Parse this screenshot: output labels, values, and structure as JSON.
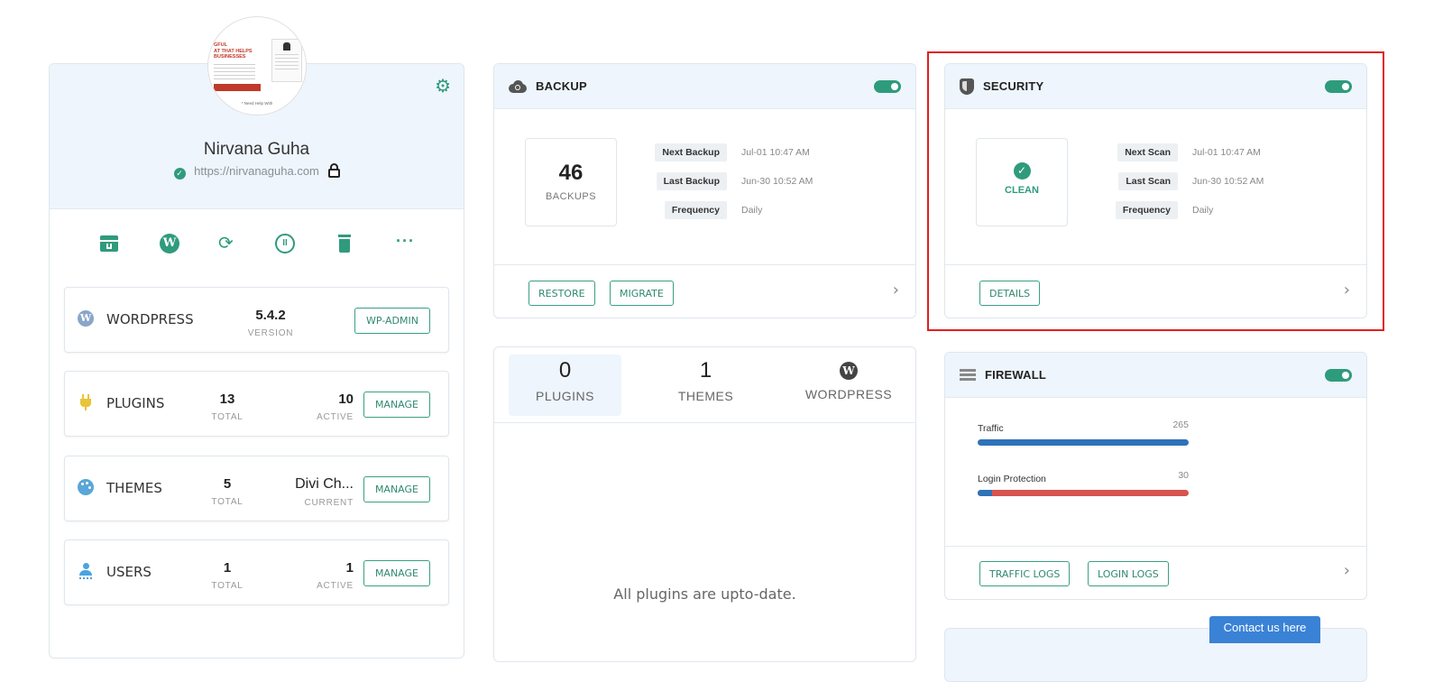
{
  "site": {
    "name": "Nirvana Guha",
    "url": "https://nirvanaguha.com",
    "thumbnail_text": {
      "headline": "GFUL\nAT THAT HELPS\nBUSINESSES",
      "caption": "* Need Help With"
    }
  },
  "actions": [
    "archive",
    "wordpress",
    "sync",
    "pause",
    "delete",
    "more"
  ],
  "info_rows": [
    {
      "label": "WORDPRESS",
      "stat1_value": "5.4.2",
      "stat1_label": "VERSION",
      "button": "WP-ADMIN"
    },
    {
      "label": "PLUGINS",
      "stat1_value": "13",
      "stat1_label": "TOTAL",
      "stat2_value": "10",
      "stat2_label": "ACTIVE",
      "button": "MANAGE"
    },
    {
      "label": "THEMES",
      "stat1_value": "5",
      "stat1_label": "TOTAL",
      "stat2_value": "Divi Ch...",
      "stat2_label": "CURRENT",
      "button": "MANAGE"
    },
    {
      "label": "USERS",
      "stat1_value": "1",
      "stat1_label": "TOTAL",
      "stat2_value": "1",
      "stat2_label": "ACTIVE",
      "button": "MANAGE"
    }
  ],
  "backup": {
    "title": "BACKUP",
    "count": "46",
    "count_label": "BACKUPS",
    "details": [
      {
        "label": "Next Backup",
        "value": "Jul-01 10:47 AM"
      },
      {
        "label": "Last Backup",
        "value": "Jun-30 10:52 AM"
      },
      {
        "label": "Frequency",
        "value": "Daily"
      }
    ],
    "buttons": [
      "RESTORE",
      "MIGRATE"
    ]
  },
  "security": {
    "title": "SECURITY",
    "status": "CLEAN",
    "details": [
      {
        "label": "Next Scan",
        "value": "Jul-01 10:47 AM"
      },
      {
        "label": "Last Scan",
        "value": "Jun-30 10:52 AM"
      },
      {
        "label": "Frequency",
        "value": "Daily"
      }
    ],
    "button": "DETAILS"
  },
  "updates": {
    "tabs": [
      {
        "count": "0",
        "label": "PLUGINS"
      },
      {
        "count": "1",
        "label": "THEMES"
      },
      {
        "count": "",
        "label": "WORDPRESS"
      }
    ],
    "message": "All plugins are upto-date."
  },
  "firewall": {
    "title": "FIREWALL",
    "metrics": [
      {
        "label": "Traffic",
        "value": "265",
        "fill": 1.0,
        "color": "#2f72b8"
      },
      {
        "label": "Login Protection",
        "value": "30",
        "fill": 0.07,
        "color": "#2f72b8"
      }
    ],
    "buttons": [
      "TRAFFIC LOGS",
      "LOGIN LOGS"
    ]
  },
  "contact": {
    "label": "Contact us here"
  },
  "colors": {
    "accent": "#2f9b7d",
    "highlight": "#e02020",
    "bar_bg": "#d9534f",
    "contact_bg": "#3a82d6"
  }
}
